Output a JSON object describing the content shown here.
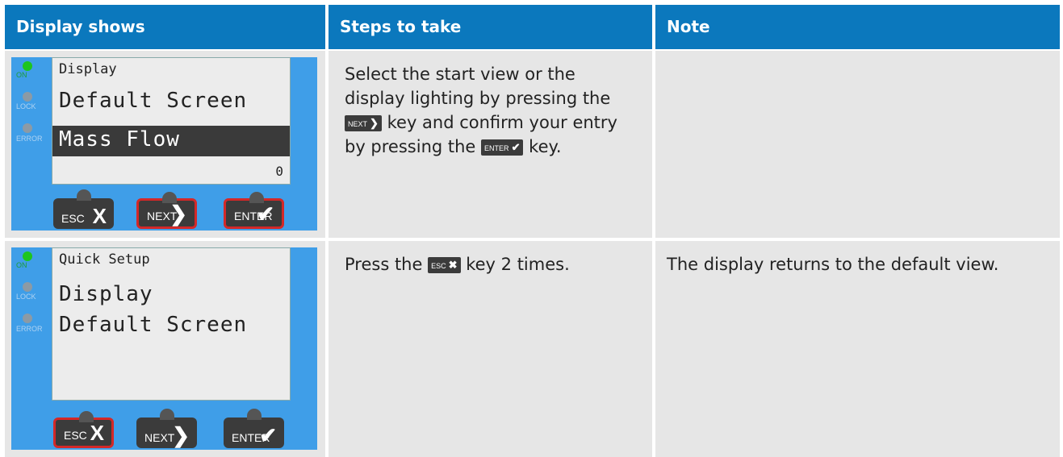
{
  "headers": [
    "Display shows",
    "Steps to take",
    "Note"
  ],
  "device_leds": [
    "ON",
    "LOCK",
    "ERROR"
  ],
  "device_keys": [
    {
      "label": "ESC",
      "symbol": "X"
    },
    {
      "label": "NEXT",
      "symbol": "❯"
    },
    {
      "label": "ENTER",
      "symbol": "✔"
    }
  ],
  "rows": [
    {
      "screen": {
        "line1": "Display",
        "line2": "Default Screen",
        "line3": "Mass Flow",
        "counter": "0"
      },
      "steps": {
        "part1": "Select the start view or the display lighting by pressing the",
        "part2": "key and confirm your entry by pressing the",
        "part3": "key."
      },
      "note": ""
    },
    {
      "screen": {
        "line1": "Quick Setup",
        "line2": "Display",
        "line3": "Default Screen"
      },
      "steps": {
        "part1": "Press the",
        "part2": "key 2 times."
      },
      "note": "The display returns to the default view."
    }
  ],
  "colors": {
    "header": "#0b78bd",
    "cell": "#e6e6e6",
    "device": "#3f9ee8",
    "active_key_border": "#d42828",
    "led_on": "#1ec51e"
  }
}
